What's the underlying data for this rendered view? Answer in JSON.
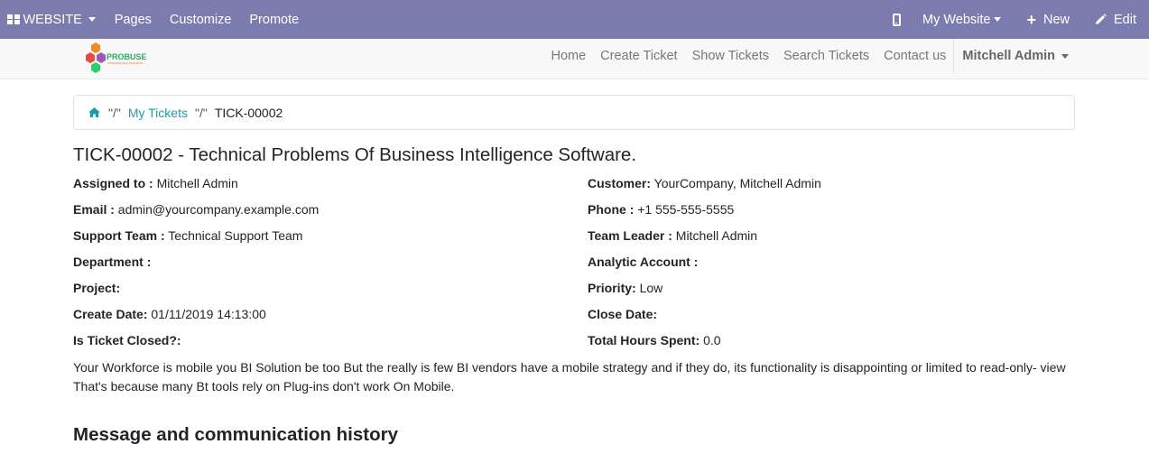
{
  "admin_bar": {
    "website_label": "WEBSITE",
    "pages_label": "Pages",
    "customize_label": "Customize",
    "promote_label": "Promote",
    "my_website_label": "My Website",
    "new_label": "New",
    "edit_label": "Edit",
    "bg_color": "#7c7bad"
  },
  "site_nav": {
    "logo_text": "PROBUSE",
    "logo_subtext": "PROFESSIONAL BUSINESS",
    "links": [
      "Home",
      "Create Ticket",
      "Show Tickets",
      "Search Tickets",
      "Contact us"
    ],
    "user_label": "Mitchell Admin"
  },
  "breadcrumb": {
    "sep1": "\"/\"",
    "my_tickets": "My Tickets",
    "sep2": "\"/\"",
    "current": "TICK-00002"
  },
  "ticket": {
    "title": "TICK-00002 - Technical Problems Of Business Intelligence Software.",
    "fields_left": [
      {
        "label": "Assigned to :",
        "value": "Mitchell Admin"
      },
      {
        "label": "Email :",
        "value": "admin@yourcompany.example.com"
      },
      {
        "label": "Support Team :",
        "value": "Technical Support Team"
      },
      {
        "label": "Department :",
        "value": ""
      },
      {
        "label": "Project:",
        "value": ""
      },
      {
        "label": "Create Date:",
        "value": "01/11/2019 14:13:00"
      },
      {
        "label": "Is Ticket Closed?:",
        "value": ""
      }
    ],
    "fields_right": [
      {
        "label": "Customer:",
        "value": "YourCompany, Mitchell Admin"
      },
      {
        "label": "Phone :",
        "value": "+1 555-555-5555"
      },
      {
        "label": "Team Leader :",
        "value": "Mitchell Admin"
      },
      {
        "label": "Analytic Account :",
        "value": ""
      },
      {
        "label": "Priority:",
        "value": "Low"
      },
      {
        "label": "Close Date:",
        "value": ""
      },
      {
        "label": "Total Hours Spent:",
        "value": "0.0"
      }
    ],
    "description": "Your Workforce is mobile you BI Solution be too But the really is few BI vendors have a mobile strategy and if they do, its functionality is disappointing or limited to read-only- view That's because many Bt tools rely on Plug-ins don't work On Mobile."
  },
  "history": {
    "title": "Message and communication history"
  }
}
